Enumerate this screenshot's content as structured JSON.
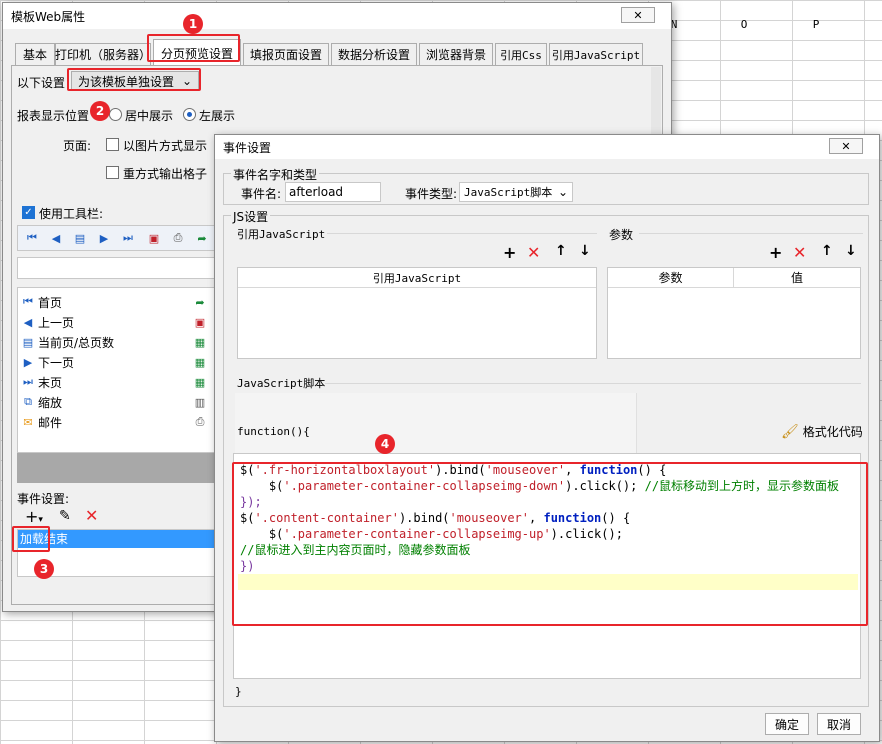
{
  "sheet": {
    "columns": [
      "N",
      "O",
      "P"
    ]
  },
  "template_window": {
    "title": "模板Web属性",
    "tabs": [
      "基本",
      "打印机（服务器）",
      "分页预览设置",
      "填报页面设置",
      "数据分析设置",
      "浏览器背景",
      "引用Css",
      "引用JavaScript"
    ],
    "active_tab": "分页预览设置",
    "setting_label": "以下设置",
    "setting_value": "为该模板单独设置",
    "position_label": "报表显示位置",
    "position_options": [
      "居中展示",
      "左展示"
    ],
    "page_label": "页面:",
    "page_options": [
      "以图片方式显示",
      "重方式输出格子"
    ],
    "toolbar_label": "使用工具栏:",
    "toolbar_items": [
      {
        "icon": "first-page-icon",
        "label": "首页"
      },
      {
        "icon": "previous-page-icon",
        "label": "上一页"
      },
      {
        "icon": "page-count-icon",
        "label": "当前页/总页数"
      },
      {
        "icon": "next-page-icon",
        "label": "下一页"
      },
      {
        "icon": "last-page-icon",
        "label": "末页"
      },
      {
        "icon": "zoom-icon",
        "label": "缩放"
      },
      {
        "icon": "mail-icon",
        "label": "邮件"
      }
    ],
    "event_label": "事件设置:",
    "event_item": "加载结束"
  },
  "badges": [
    "1",
    "2",
    "3",
    "4"
  ],
  "event_window": {
    "title": "事件设置",
    "group_name_type": "事件名字和类型",
    "event_name_label": "事件名:",
    "event_name_value": "afterload",
    "event_type_label": "事件类型:",
    "event_type_value": "JavaScript脚本",
    "js_group": "JS设置",
    "ref_js_label": "引用JavaScript",
    "param_label": "参数",
    "ref_js_header": "引用JavaScript",
    "param_headers": [
      "参数",
      "值"
    ],
    "script_label": "JavaScript脚本",
    "function_head": "function(){",
    "format_button": "格式化代码",
    "code": {
      "l1a": "$(",
      "l1b": "'.fr-horizontalboxlayout'",
      "l1c": ").bind(",
      "l1d": "'mouseover'",
      "l1e": ", ",
      "l1f": "function",
      "l1g": "() {",
      "l2a": "    $(",
      "l2b": "'.parameter-container-collapseimg-down'",
      "l2c": ").click(); ",
      "l2d": "//鼠标移动到上方时，显示参数面板",
      "l3": "});",
      "l4a": "$(",
      "l4b": "'.content-container'",
      "l4c": ").bind(",
      "l4d": "'mouseover'",
      "l4e": ", ",
      "l4f": "function",
      "l4g": "() {",
      "l5a": "    $(",
      "l5b": "'.parameter-container-collapseimg-up'",
      "l5c": ").click();",
      "l6": "//鼠标进入到主内容页面时，隐藏参数面板",
      "l7": "})"
    },
    "closing_brace": "}",
    "ok": "确定",
    "cancel": "取消"
  },
  "colors": {
    "highlight": "#e8252b",
    "accent": "#1e73d4",
    "selection": "#3399ff",
    "code_highlight_line": "#ffffc8"
  }
}
